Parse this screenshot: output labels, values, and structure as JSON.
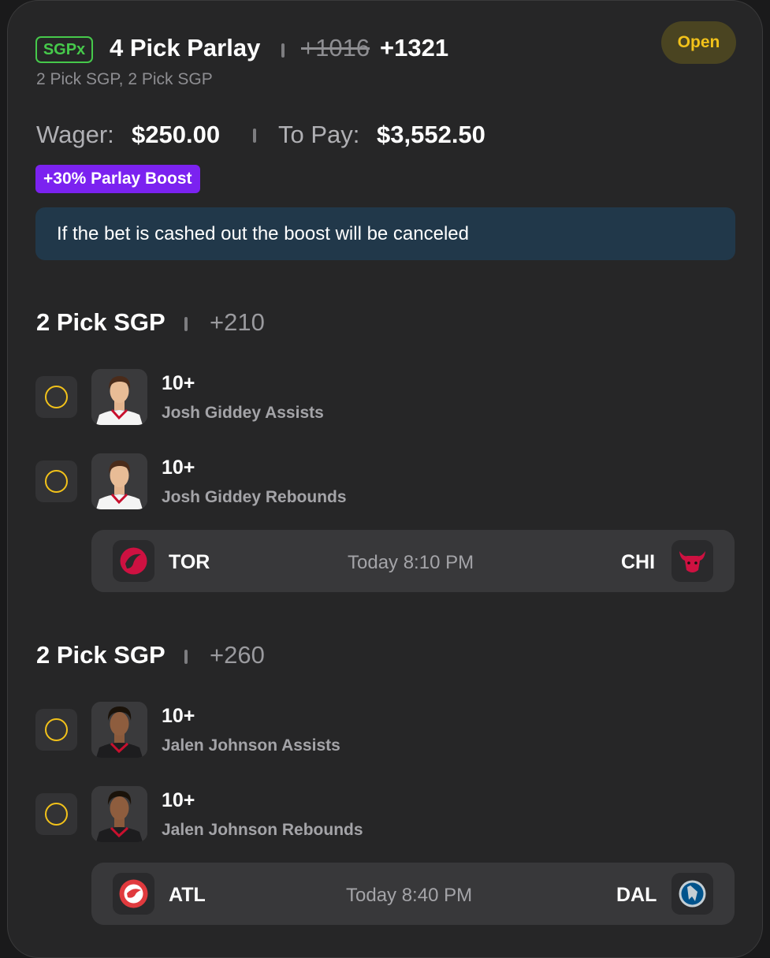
{
  "bet": {
    "badge": "SGPx",
    "title": "4 Pick Parlay",
    "old_odds": "+1016",
    "new_odds": "+1321",
    "subtitle": "2 Pick SGP, 2 Pick SGP",
    "status": "Open",
    "wager_label": "Wager:",
    "wager_value": "$250.00",
    "pay_label": "To Pay:",
    "pay_value": "$3,552.50",
    "boost": "+30% Parlay Boost",
    "info": "If the bet is cashed out the boost will be canceled"
  },
  "groups": [
    {
      "title": "2 Pick SGP",
      "odds": "+210",
      "picks": [
        {
          "line": "10+",
          "desc": "Josh Giddey Assists"
        },
        {
          "line": "10+",
          "desc": "Josh Giddey Rebounds"
        }
      ],
      "game": {
        "away": "TOR",
        "time": "Today 8:10 PM",
        "home": "CHI"
      }
    },
    {
      "title": "2 Pick SGP",
      "odds": "+260",
      "picks": [
        {
          "line": "10+",
          "desc": "Jalen Johnson Assists"
        },
        {
          "line": "10+",
          "desc": "Jalen Johnson Rebounds"
        }
      ],
      "game": {
        "away": "ATL",
        "time": "Today 8:40 PM",
        "home": "DAL"
      }
    }
  ],
  "colors": {
    "accent_yellow": "#f2c21a",
    "sgpx_green": "#46c94b",
    "boost_purple": "#7b22f0",
    "info_bg": "#21384a"
  },
  "icons": {
    "pick_status": "open-circle-icon",
    "player": "player-headshot",
    "team_logos": [
      "raptors-logo",
      "bulls-logo",
      "hawks-logo",
      "mavericks-logo"
    ]
  }
}
